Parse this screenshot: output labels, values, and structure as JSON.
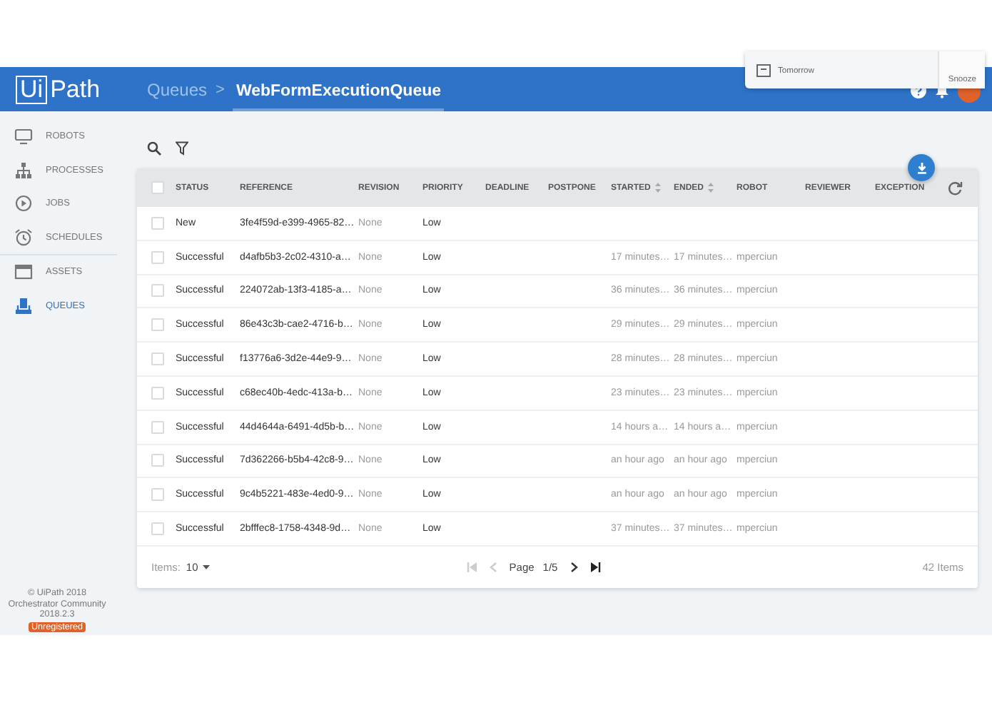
{
  "header": {
    "logo_left": "Ui",
    "logo_right": "Path",
    "breadcrumb": "Queues",
    "separator": ">",
    "title": "WebFormExecutionQueue"
  },
  "notification": {
    "text": "Tomorrow",
    "action": "Snooze"
  },
  "sidebar": {
    "items": [
      {
        "label": "ROBOTS",
        "selected": false
      },
      {
        "label": "PROCESSES",
        "selected": false
      },
      {
        "label": "JOBS",
        "selected": false
      },
      {
        "label": "SCHEDULES",
        "selected": false
      },
      {
        "label": "ASSETS",
        "selected": false
      },
      {
        "label": "QUEUES",
        "selected": true
      }
    ]
  },
  "table": {
    "select_all_checked": false,
    "columns": [
      {
        "label": "STATUS",
        "sortable": false
      },
      {
        "label": "REFERENCE",
        "sortable": false
      },
      {
        "label": "REVISION",
        "sortable": false
      },
      {
        "label": "PRIORITY",
        "sortable": false
      },
      {
        "label": "DEADLINE",
        "sortable": false
      },
      {
        "label": "POSTPONE",
        "sortable": false
      },
      {
        "label": "STARTED",
        "sortable": true
      },
      {
        "label": "ENDED",
        "sortable": true
      },
      {
        "label": "ROBOT",
        "sortable": false
      },
      {
        "label": "REVIEWER",
        "sortable": false
      },
      {
        "label": "EXCEPTION",
        "sortable": false
      }
    ],
    "rows": [
      {
        "checked": false,
        "status": "New",
        "reference": "3fe4f59d-e399-4965-82…",
        "revision": "None",
        "priority": "Low"
      },
      {
        "checked": false,
        "status": "Successful",
        "reference": "d4afb5b3-2c02-4310-a…",
        "revision": "None",
        "priority": "Low",
        "started": "17 minutes…",
        "ended": "17 minutes…",
        "robot": "mperciun"
      },
      {
        "checked": false,
        "status": "Successful",
        "reference": "224072ab-13f3-4185-a…",
        "revision": "None",
        "priority": "Low",
        "started": "36 minutes…",
        "ended": "36 minutes…",
        "robot": "mperciun"
      },
      {
        "checked": false,
        "status": "Successful",
        "reference": "86e43c3b-cae2-4716-b…",
        "revision": "None",
        "priority": "Low",
        "started": "29 minutes…",
        "ended": "29 minutes…",
        "robot": "mperciun"
      },
      {
        "checked": false,
        "status": "Successful",
        "reference": "f13776a6-3d2e-44e9-9…",
        "revision": "None",
        "priority": "Low",
        "started": "28 minutes…",
        "ended": "28 minutes…",
        "robot": "mperciun"
      },
      {
        "checked": false,
        "status": "Successful",
        "reference": "c68ec40b-4edc-413a-b…",
        "revision": "None",
        "priority": "Low",
        "started": "23 minutes…",
        "ended": "23 minutes…",
        "robot": "mperciun"
      },
      {
        "checked": false,
        "status": "Successful",
        "reference": "44d4644a-6491-4d5b-b…",
        "revision": "None",
        "priority": "Low",
        "started": "14 hours a…",
        "ended": "14 hours a…",
        "robot": "mperciun"
      },
      {
        "checked": false,
        "status": "Successful",
        "reference": "7d362266-b5b4-42c8-9…",
        "revision": "None",
        "priority": "Low",
        "started": "an hour ago",
        "ended": "an hour ago",
        "robot": "mperciun"
      },
      {
        "checked": false,
        "status": "Successful",
        "reference": "9c4b5221-483e-4ed0-9…",
        "revision": "None",
        "priority": "Low",
        "started": "an hour ago",
        "ended": "an hour ago",
        "robot": "mperciun"
      },
      {
        "checked": false,
        "status": "Successful",
        "reference": "2bfffec8-1758-4348-9d…",
        "revision": "None",
        "priority": "Low",
        "started": "37 minutes…",
        "ended": "37 minutes…",
        "robot": "mperciun"
      }
    ]
  },
  "pagination": {
    "items_label": "Items:",
    "page_size": "10",
    "page_label": "Page",
    "page": "1/5",
    "total": "42 Items"
  },
  "footer": {
    "copyright": "© UiPath 2018",
    "product": "Orchestrator Community",
    "version": "2018.2.3",
    "badge": "Unregistered"
  }
}
